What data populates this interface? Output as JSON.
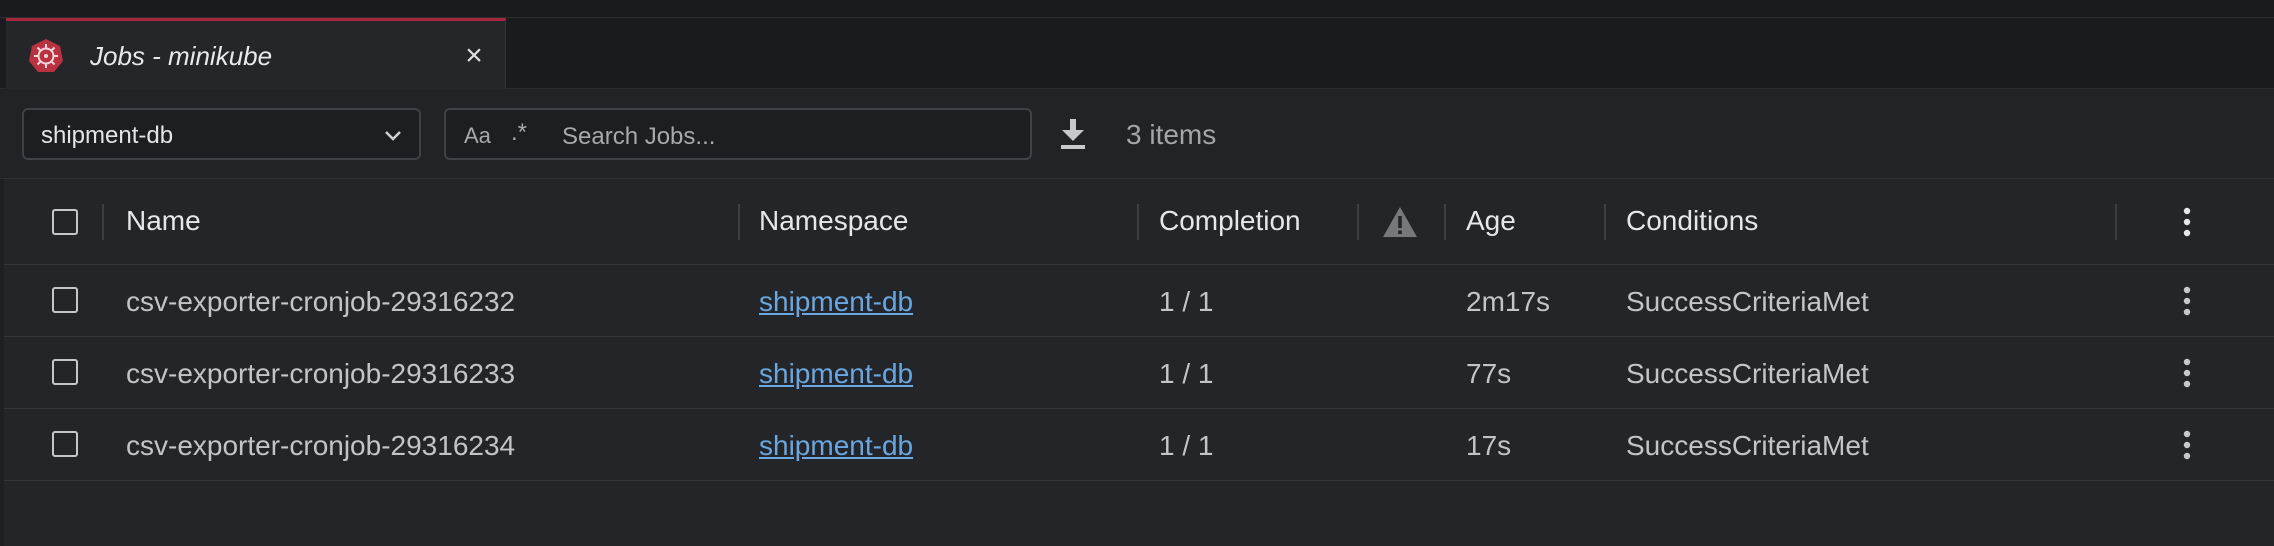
{
  "tab": {
    "title": "Jobs - minikube",
    "close_glyph": "×",
    "icon": "kubernetes-helm-icon"
  },
  "toolbar": {
    "namespace_selected": "shipment-db",
    "search_case_label": "Aa",
    "search_regex_label": ".*",
    "search_placeholder": "Search Jobs...",
    "item_count": "3 items"
  },
  "table": {
    "columns": [
      "Name",
      "Namespace",
      "Completion",
      "Age",
      "Conditions"
    ],
    "rows": [
      {
        "name": "csv-exporter-cronjob-29316232",
        "namespace": "shipment-db",
        "completion": "1 / 1",
        "age": "2m17s",
        "conditions": "SuccessCriteriaMet"
      },
      {
        "name": "csv-exporter-cronjob-29316233",
        "namespace": "shipment-db",
        "completion": "1 / 1",
        "age": "77s",
        "conditions": "SuccessCriteriaMet"
      },
      {
        "name": "csv-exporter-cronjob-29316234",
        "namespace": "shipment-db",
        "completion": "1 / 1",
        "age": "17s",
        "conditions": "SuccessCriteriaMet"
      }
    ]
  },
  "colors": {
    "accent": "#a8293d",
    "link": "#6aa6e0",
    "background": "#1e1f22"
  }
}
